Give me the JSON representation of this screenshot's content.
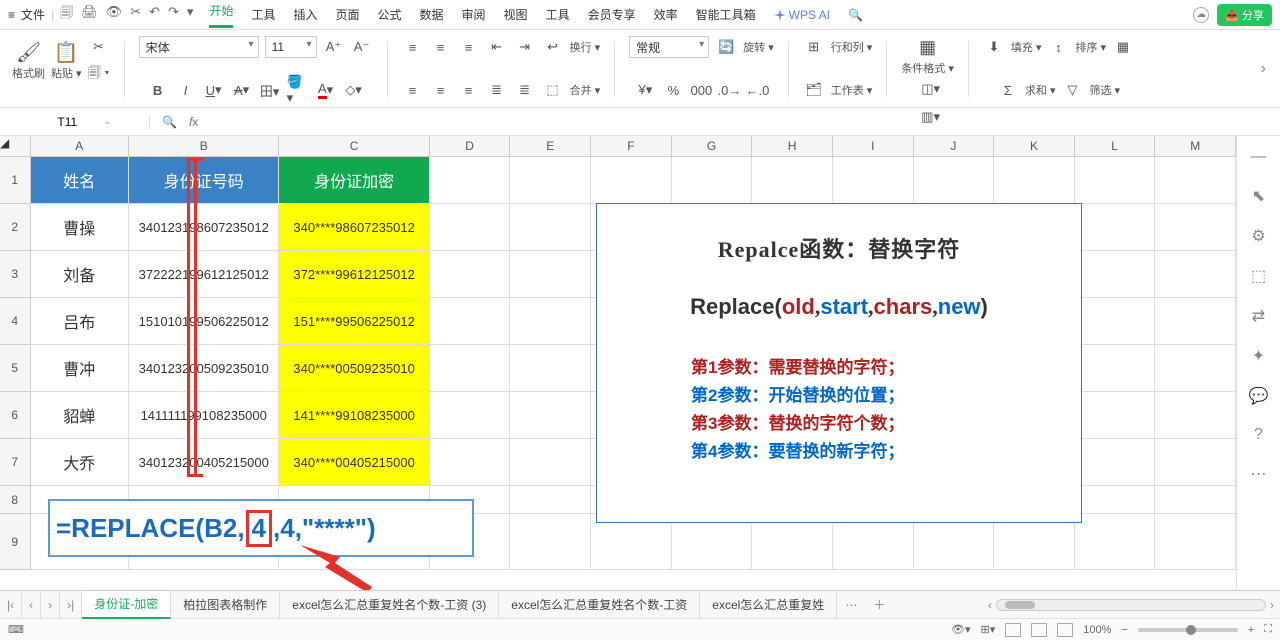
{
  "menu": {
    "file": "文件",
    "tabs": [
      "开始",
      "工具",
      "插入",
      "页面",
      "公式",
      "数据",
      "审阅",
      "视图",
      "工具",
      "会员专享",
      "效率",
      "智能工具箱"
    ],
    "active": "开始",
    "wps_ai": "WPS AI",
    "share": "分享"
  },
  "ribbon": {
    "brush": "格式刷",
    "paste": "粘贴",
    "font_name": "宋体",
    "font_size": "11",
    "wrap": "换行",
    "number_format": "常规",
    "merge": "合并",
    "rotate": "旋转",
    "rowcol": "行和列",
    "worksheet": "工作表",
    "cond_fmt": "条件格式",
    "fill": "填充",
    "sort": "排序",
    "sum": "求和",
    "filter": "筛选"
  },
  "fx": {
    "namebox": "T11",
    "formula": ""
  },
  "columns": [
    "A",
    "B",
    "C",
    "D",
    "E",
    "F",
    "G",
    "H",
    "I",
    "J",
    "K",
    "L",
    "M"
  ],
  "headers": {
    "A": "姓名",
    "B": "身份证号码",
    "C": "身份证加密"
  },
  "table_rows": [
    {
      "name": "曹操",
      "id": "340123198607235012",
      "enc": "340****98607235012"
    },
    {
      "name": "刘备",
      "id": "372222199612125012",
      "enc": "372****99612125012"
    },
    {
      "name": "吕布",
      "id": "151010199506225012",
      "enc": "151****99506225012"
    },
    {
      "name": "曹冲",
      "id": "340123200509235010",
      "enc": "340****00509235010"
    },
    {
      "name": "貂蝉",
      "id": "141111199108235000",
      "enc": "141****99108235000"
    },
    {
      "name": "大乔",
      "id": "340123200405215000",
      "enc": "340****00405215000"
    }
  ],
  "annotation": {
    "title": "Repalce函数：替换字符",
    "fn_prefix": "Replace(",
    "fn_old": "old",
    "fn_start": "start",
    "fn_chars": "chars",
    "fn_new": "new",
    "fn_suffix": ")",
    "p1": "第1参数：需要替换的字符；",
    "p2": "第2参数：开始替换的位置；",
    "p3": "第3参数：替换的字符个数；",
    "p4": "第4参数：要替换的新字符；"
  },
  "formula_display": {
    "pre": "=REPLACE(B2,",
    "highlight": "4",
    "post": ",4,\"****\")"
  },
  "sheets": {
    "active": "身份证-加密",
    "others": [
      "柏拉图表格制作",
      "excel怎么汇总重复姓名个数-工资 (3)",
      "excel怎么汇总重复姓名个数-工资",
      "excel怎么汇总重复姓"
    ]
  },
  "status": {
    "zoom": "100%"
  },
  "chart_data": {
    "type": "table",
    "title": "身份证加密 (REPLACE demo)",
    "columns": [
      "姓名",
      "身份证号码",
      "身份证加密"
    ],
    "rows": [
      [
        "曹操",
        "340123198607235012",
        "340****98607235012"
      ],
      [
        "刘备",
        "372222199612125012",
        "372****99612125012"
      ],
      [
        "吕布",
        "151010199506225012",
        "151****99506225012"
      ],
      [
        "曹冲",
        "340123200509235010",
        "340****00509235010"
      ],
      [
        "貂蝉",
        "141111199108235000",
        "141****99108235000"
      ],
      [
        "大乔",
        "340123200405215000",
        "340****00405215000"
      ]
    ]
  }
}
